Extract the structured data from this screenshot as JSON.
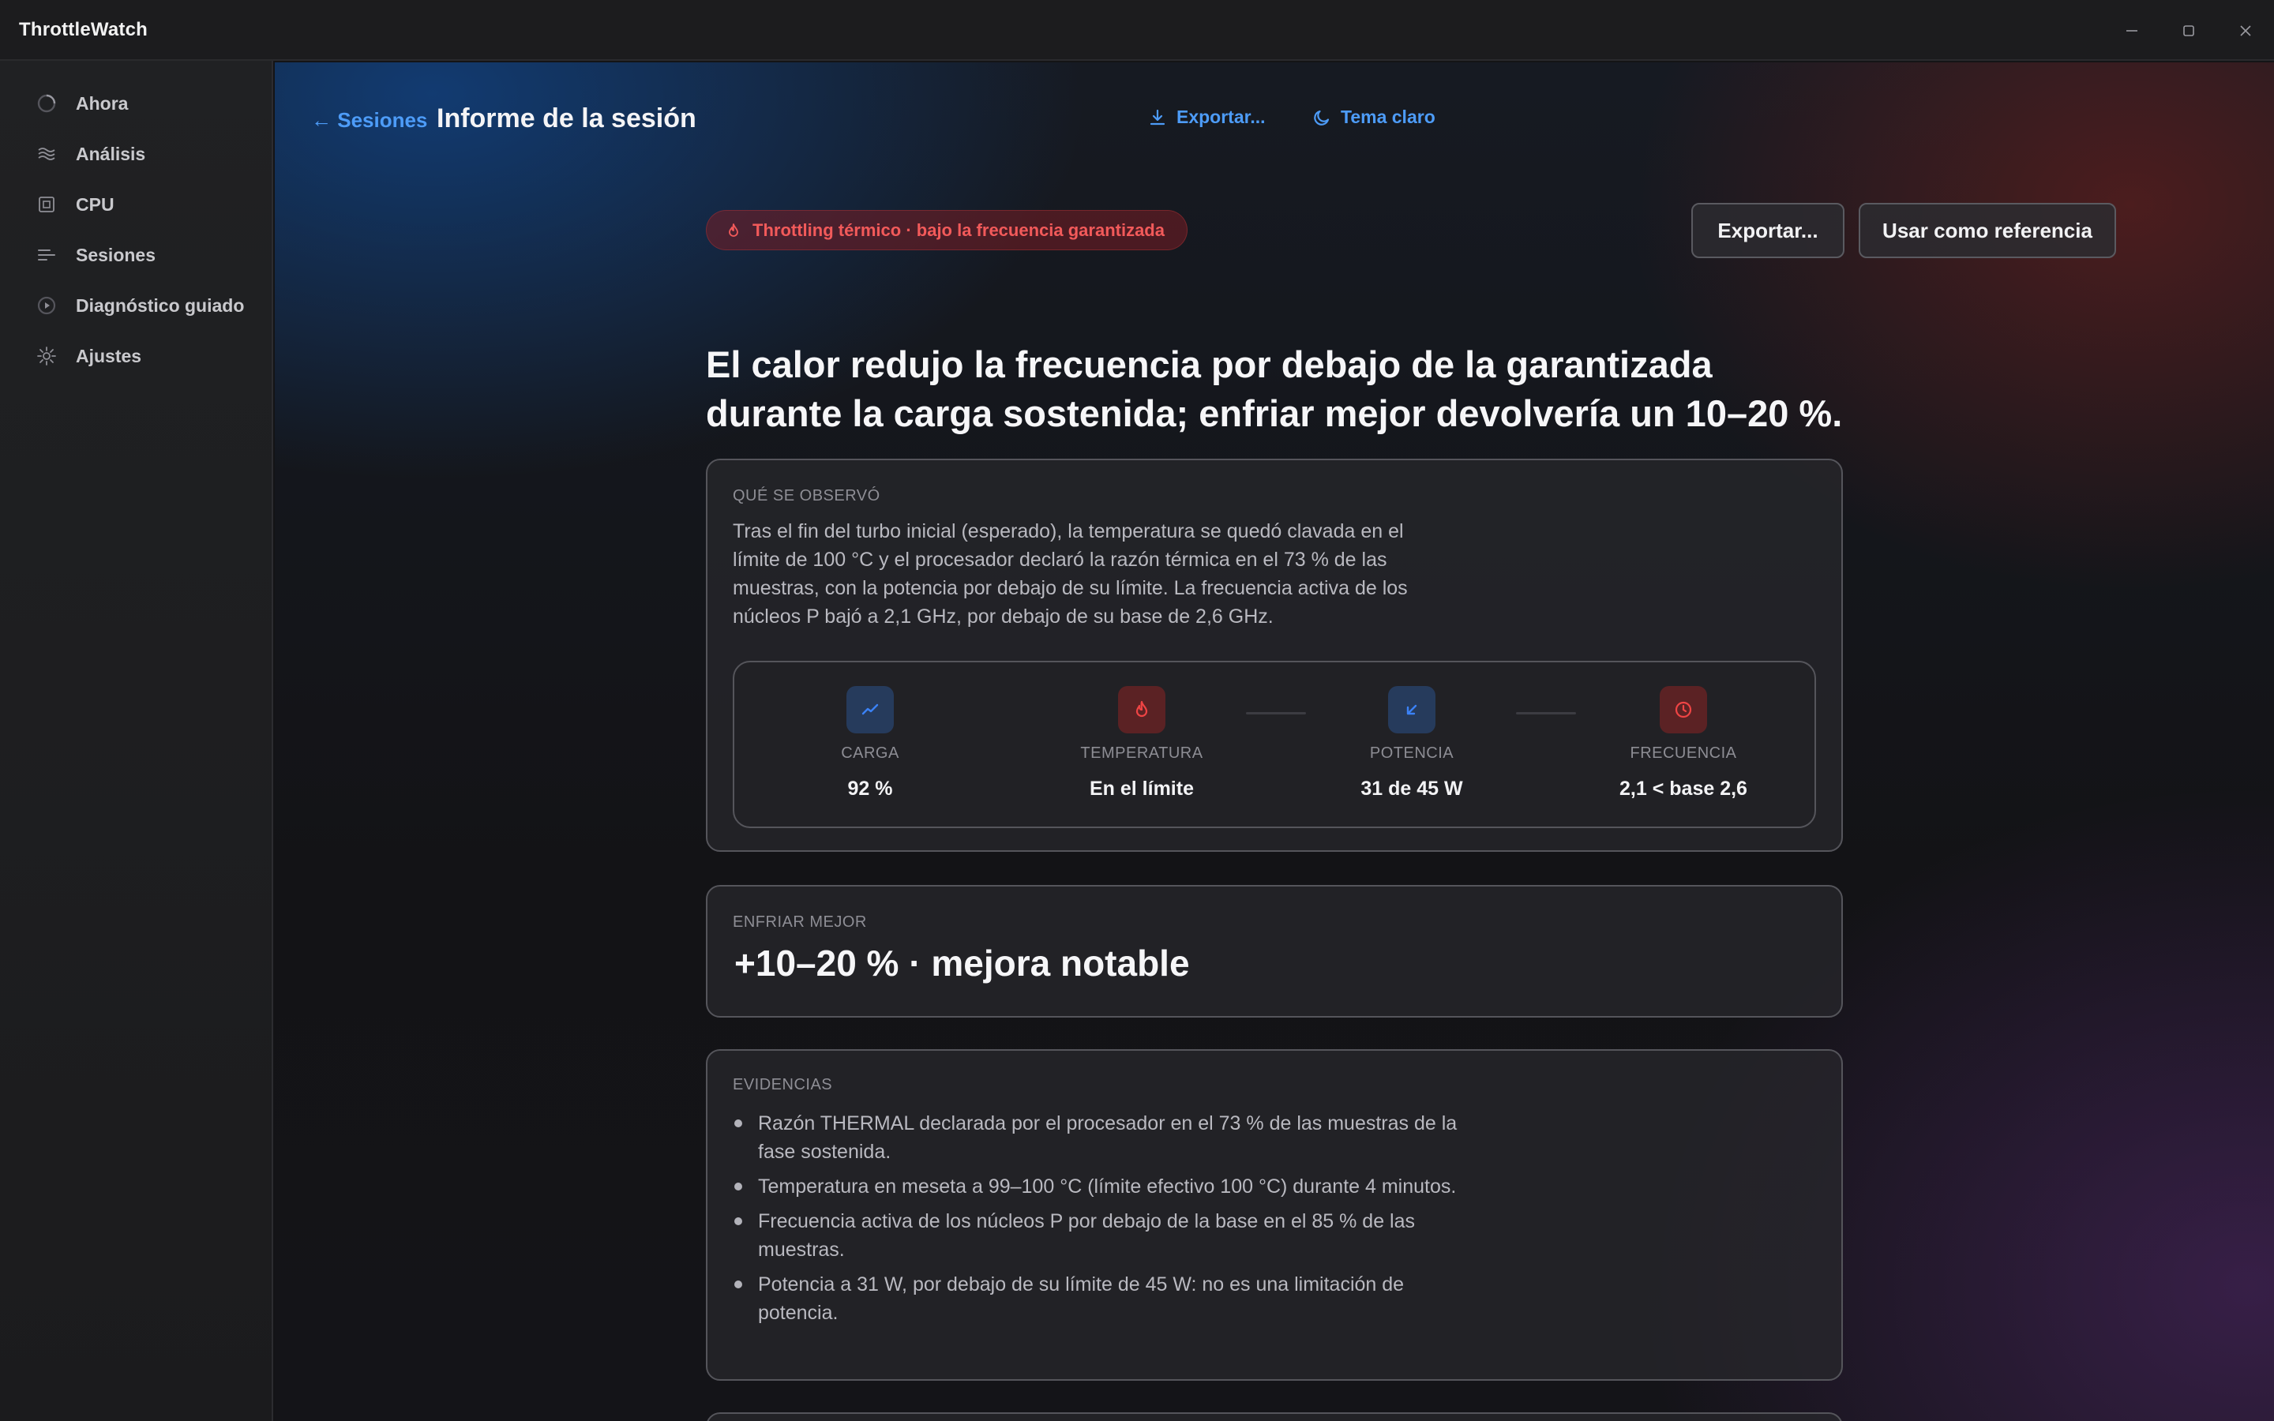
{
  "window": {
    "title": "ThrottleWatch"
  },
  "sidebar": {
    "items": [
      {
        "label": "Ahora",
        "icon": "spinner-icon"
      },
      {
        "label": "Análisis",
        "icon": "waves-icon"
      },
      {
        "label": "CPU",
        "icon": "cpu-icon"
      },
      {
        "label": "Sesiones",
        "icon": "list-icon"
      },
      {
        "label": "Diagnóstico guiado",
        "icon": "play-circle-icon"
      },
      {
        "label": "Ajustes",
        "icon": "gear-icon"
      }
    ]
  },
  "header": {
    "back_label": "← Sesiones",
    "title": "Informe de la sesión",
    "export_label": "Exportar...",
    "theme_label": "Tema claro"
  },
  "report": {
    "badge": "Throttling térmico · bajo la frecuencia garantizada",
    "export_button": "Exportar...",
    "reference_button": "Usar como referencia",
    "headline": "El calor redujo la frecuencia por debajo de la garantizada durante la carga sostenida; enfriar mejor devolvería un 10–20 %.",
    "observed": {
      "label": "QUÉ SE OBSERVÓ",
      "text": "Tras el fin del turbo inicial (esperado), la temperatura se quedó clavada en el límite de 100 °C y el procesador declaró la razón térmica en el 73 % de las muestras, con la potencia por debajo de su límite. La frecuencia activa de los núcleos P bajó a 2,1 GHz, por debajo de su base de 2,6 GHz.",
      "metrics": [
        {
          "label": "CARGA",
          "value": "92 %",
          "icon": "trend-up-icon",
          "color": "#3b82f6"
        },
        {
          "label": "TEMPERATURA",
          "value": "En el límite",
          "icon": "flame-icon",
          "color": "#ef4444"
        },
        {
          "label": "POTENCIA",
          "value": "31 de 45 W",
          "icon": "arrow-down-left-icon",
          "color": "#3b82f6"
        },
        {
          "label": "FRECUENCIA",
          "value": "2,1 < base 2,6",
          "icon": "clock-icon",
          "color": "#ef4444"
        }
      ]
    },
    "improve": {
      "label": "ENFRIAR MEJOR",
      "value": "+10–20 % · mejora notable"
    },
    "evidence": {
      "label": "EVIDENCIAS",
      "items": [
        "Razón THERMAL declarada por el procesador en el 73 % de las muestras de la fase sostenida.",
        "Temperatura en meseta a 99–100 °C (límite efectivo 100 °C) durante 4 minutos.",
        "Frecuencia activa de los núcleos P por debajo de la base en el 85 % de las muestras.",
        "Potencia a 31 W, por debajo de su límite de 45 W: no es una limitación de potencia."
      ]
    }
  },
  "colors": {
    "accent": "#4d9cf8",
    "danger": "#f25a5a"
  }
}
